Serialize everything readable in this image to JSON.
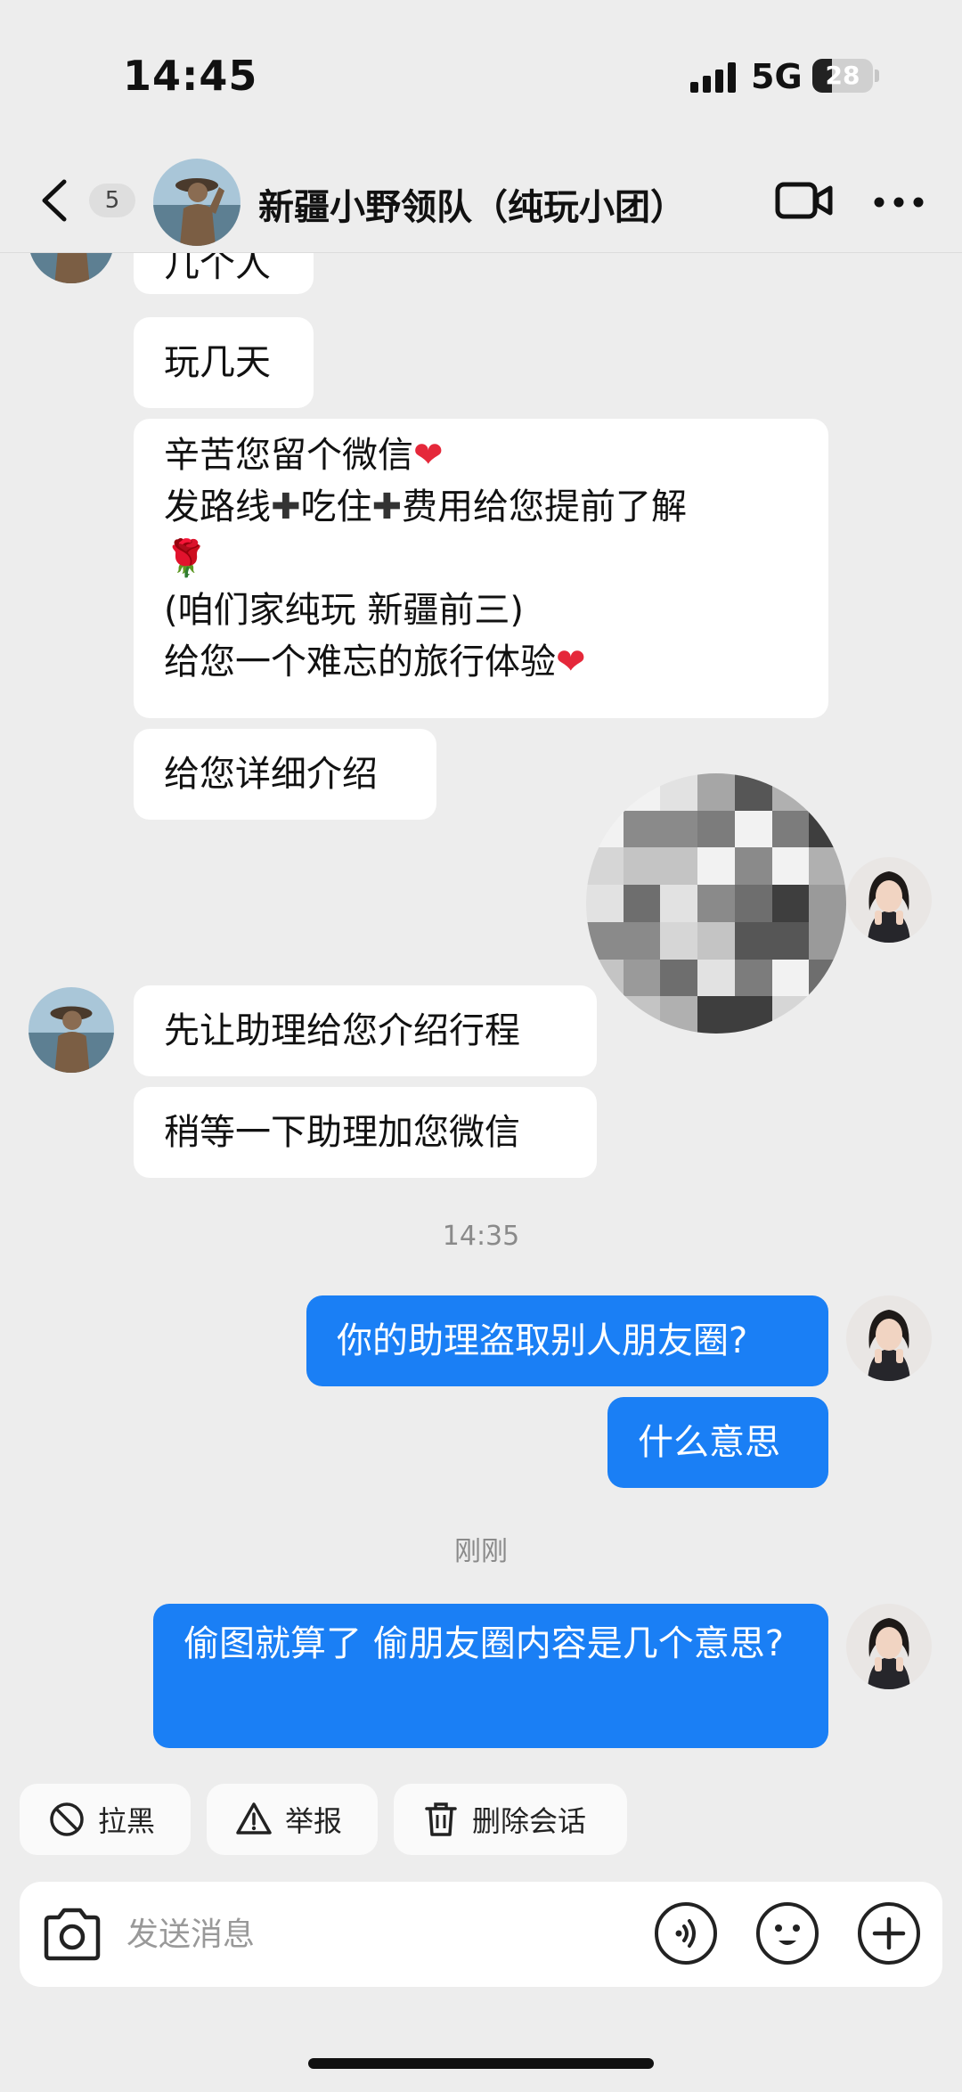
{
  "status_bar": {
    "time": "14:45",
    "network": "5G",
    "battery": "28",
    "battery_level": 0.28
  },
  "header": {
    "unread_count": "5",
    "title": "新疆小野领队（纯玩小团）",
    "icons": [
      "back-icon",
      "video-call-icon",
      "more-icon"
    ]
  },
  "messages": {
    "m0": "几个人",
    "m1": "玩几天",
    "m2": {
      "line1": "辛苦您留个微信",
      "line2a": "发路线",
      "line2b": "吃住",
      "line2c": "费用给您提前了解",
      "line3": "🌹",
      "line4": "(咱们家纯玩 新疆前三)",
      "line5": "给您一个难忘的旅行体验",
      "heart": "❤",
      "plus": "✚"
    },
    "m3": "给您详细介绍",
    "m4": "先让助理给您介绍行程",
    "m5": "稍等一下助理加您微信",
    "t1": "14:35",
    "m6": "你的助理盗取别人朋友圈?",
    "m7": "什么意思",
    "t2": "刚刚",
    "m8": "偷图就算了 偷朋友圈内容是几个意思?"
  },
  "actions": {
    "block": "拉黑",
    "report": "举报",
    "delete": "删除会话"
  },
  "input": {
    "placeholder": "发送消息",
    "icons": [
      "camera-icon",
      "voice-icon",
      "emoji-icon",
      "plus-icon"
    ]
  },
  "colors": {
    "background": "#ededed",
    "outgoing_bubble": "#1a7ff5",
    "incoming_bubble": "#ffffff",
    "heart": "#e5283a"
  }
}
